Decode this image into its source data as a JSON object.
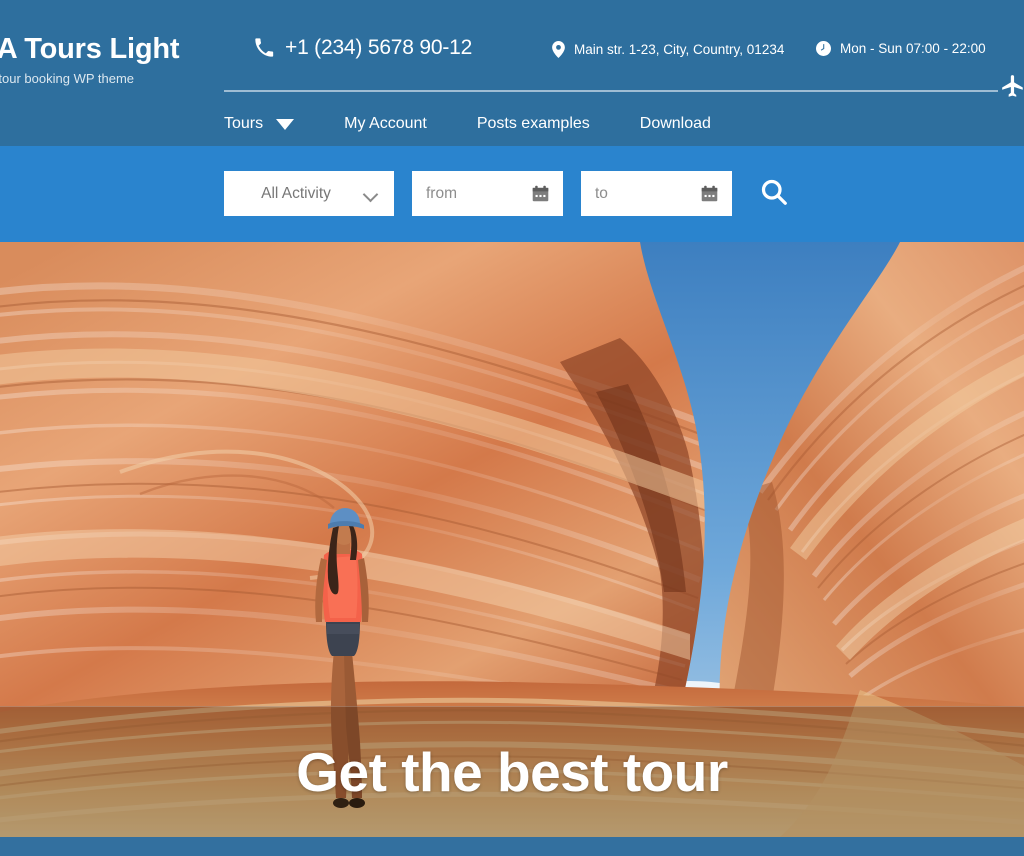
{
  "header": {
    "brand_title": "BA Tours Light",
    "brand_tagline": "ree tour booking WP theme",
    "phone": "+1 (234) 5678 90-12",
    "address": "Main str. 1-23, City, Country, 01234",
    "hours": "Mon - Sun 07:00 - 22:00",
    "phone_icon": "phone-icon",
    "address_icon": "map-pin-icon",
    "hours_icon": "clock-icon",
    "plane_icon": "airplane-icon",
    "bg_color": "#2e6f9e",
    "rule_color": "#9fbdd4"
  },
  "nav": {
    "items": [
      {
        "label": "Tours",
        "has_dropdown": true
      },
      {
        "label": "My Account",
        "has_dropdown": false
      },
      {
        "label": "Posts examples",
        "has_dropdown": false
      },
      {
        "label": "Download",
        "has_dropdown": false
      }
    ]
  },
  "search": {
    "bg_color": "#2a84ce",
    "activity_selected": "All Activity",
    "activity_icon": "chevron-down-icon",
    "date_from_placeholder": "from",
    "date_from_value": "",
    "date_to_placeholder": "to",
    "date_to_value": "",
    "calendar_icon": "calendar-icon",
    "search_icon": "search-icon"
  },
  "hero": {
    "headline": "Get the best tour",
    "image_alt": "Sandstone canyon with a woman hiking",
    "overlay_color": "rgba(60,30,10,0.30)"
  },
  "footer": {
    "bg_color": "#33709f"
  }
}
